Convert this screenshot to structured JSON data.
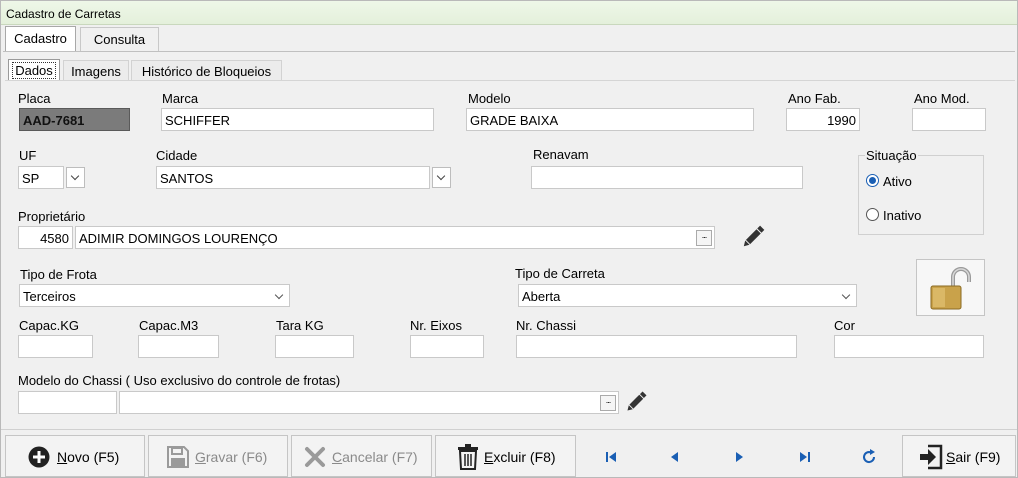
{
  "window": {
    "title": "Cadastro de Carretas"
  },
  "outer_tabs": [
    {
      "label": "Cadastro",
      "active": true
    },
    {
      "label": "Consulta",
      "active": false
    }
  ],
  "inner_tabs": [
    {
      "label": "Dados",
      "active": true
    },
    {
      "label": "Imagens",
      "active": false
    },
    {
      "label": "Histórico de Bloqueios",
      "active": false
    }
  ],
  "fields": {
    "placa": {
      "label": "Placa",
      "value": "AAD-7681"
    },
    "marca": {
      "label": "Marca",
      "value": "SCHIFFER"
    },
    "modelo": {
      "label": "Modelo",
      "value": "GRADE BAIXA"
    },
    "ano_fab": {
      "label": "Ano Fab.",
      "value": "1990"
    },
    "ano_mod": {
      "label": "Ano Mod.",
      "value": ""
    },
    "uf": {
      "label": "UF",
      "value": "SP"
    },
    "cidade": {
      "label": "Cidade",
      "value": "SANTOS"
    },
    "renavam": {
      "label": "Renavam",
      "value": ""
    },
    "proprietario": {
      "label": "Proprietário",
      "code": "4580",
      "name": "ADIMIR DOMINGOS LOURENÇO"
    },
    "tipo_frota": {
      "label": "Tipo de Frota",
      "value": "Terceiros"
    },
    "tipo_carreta": {
      "label": "Tipo de Carreta",
      "value": "Aberta"
    },
    "capac_kg": {
      "label": "Capac.KG",
      "value": ""
    },
    "capac_m3": {
      "label": "Capac.M3",
      "value": ""
    },
    "tara_kg": {
      "label": "Tara KG",
      "value": ""
    },
    "nr_eixos": {
      "label": "Nr. Eixos",
      "value": ""
    },
    "nr_chassi": {
      "label": "Nr. Chassi",
      "value": ""
    },
    "cor": {
      "label": "Cor",
      "value": ""
    },
    "modelo_chassi": {
      "label": "Modelo do Chassi ( Uso exclusivo do controle de frotas)",
      "code": "",
      "name": ""
    }
  },
  "situacao": {
    "label": "Situação",
    "options": [
      {
        "label": "Ativo",
        "selected": true
      },
      {
        "label": "Inativo",
        "selected": false
      }
    ]
  },
  "icons": {
    "edit": "pencil-icon",
    "lock": "padlock-open-icon",
    "lookup": "ellipsis-icon"
  },
  "buttons": {
    "novo": {
      "accel": "N",
      "rest": "ovo (F5)",
      "icon": "plus-circle-icon"
    },
    "gravar": {
      "accel": "G",
      "rest": "ravar (F6)",
      "icon": "save-icon",
      "enabled": false
    },
    "cancelar": {
      "accel": "C",
      "rest": "ancelar (F7)",
      "icon": "x-icon",
      "enabled": false
    },
    "excluir": {
      "accel": "E",
      "rest": "xcluir (F8)",
      "icon": "trash-icon"
    },
    "sair": {
      "accel": "S",
      "rest": "air (F9)",
      "icon": "exit-icon"
    }
  },
  "colors": {
    "accent": "#1a5fb4",
    "title_bg": "#e4f0db",
    "placa_bg": "#7b7b7b"
  }
}
